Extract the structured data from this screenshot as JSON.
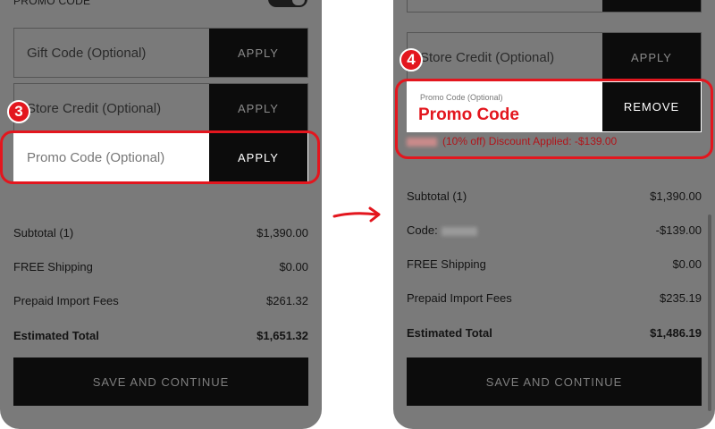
{
  "left": {
    "header": "PROMO CODE",
    "gift_code": {
      "placeholder": "Gift Code (Optional)",
      "button": "APPLY"
    },
    "store_credit": {
      "placeholder": "Store Credit (Optional)",
      "button": "APPLY"
    },
    "promo_code": {
      "placeholder": "Promo Code (Optional)",
      "button": "APPLY"
    },
    "step_number": "3",
    "summary": [
      {
        "label": "Subtotal (1)",
        "value": "$1,390.00"
      },
      {
        "label": "FREE Shipping",
        "value": "$0.00"
      },
      {
        "label": "Prepaid Import Fees",
        "value": "$261.32"
      },
      {
        "label": "Estimated Total",
        "value": "$1,651.32"
      }
    ],
    "cta": "SAVE AND CONTINUE"
  },
  "right": {
    "store_credit": {
      "placeholder": "Store Credit (Optional)",
      "button": "APPLY"
    },
    "promo_code": {
      "small_label": "Promo Code (Optional)",
      "value": "Promo Code",
      "button": "REMOVE"
    },
    "discount_text": "(10% off) Discount Applied: -$139.00",
    "step_number": "4",
    "summary": [
      {
        "label": "Subtotal (1)",
        "value": "$1,390.00"
      },
      {
        "label": "Code:",
        "value": "-$139.00"
      },
      {
        "label": "FREE Shipping",
        "value": "$0.00"
      },
      {
        "label": "Prepaid Import Fees",
        "value": "$235.19"
      },
      {
        "label": "Estimated Total",
        "value": "$1,486.19"
      }
    ],
    "cta": "SAVE AND CONTINUE"
  },
  "colors": {
    "accent": "#e3161e",
    "button": "#0c0c0c",
    "overlay": "#7a7a7a"
  }
}
